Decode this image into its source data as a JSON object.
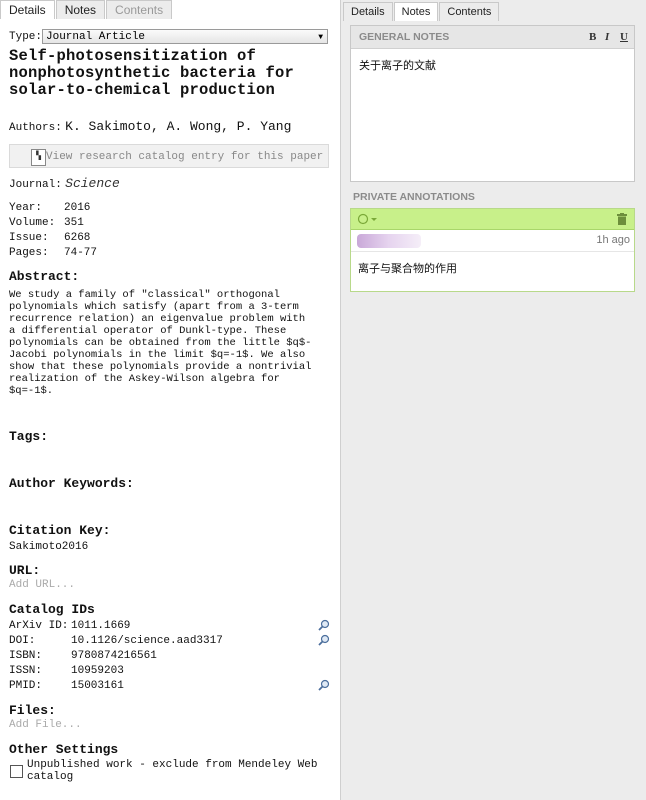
{
  "left_tabs": [
    "Details",
    "Notes",
    "Contents"
  ],
  "right_tabs": [
    "Details",
    "Notes",
    "Contents"
  ],
  "type": {
    "label": "Type:",
    "value": "Journal Article"
  },
  "title": "Self-photosensitization of nonphotosynthetic bacteria for solar-to-chemical production",
  "authors": {
    "label": "Authors:",
    "value": "K. Sakimoto, A. Wong, P. Yang"
  },
  "catalog_button": "View research catalog entry for this paper",
  "journal": {
    "label": "Journal:",
    "value": "Science"
  },
  "meta": [
    {
      "k": "Year:",
      "v": "2016"
    },
    {
      "k": "Volume:",
      "v": "351"
    },
    {
      "k": "Issue:",
      "v": "6268"
    },
    {
      "k": "Pages:",
      "v": "74-77"
    }
  ],
  "abstract": {
    "heading": "Abstract:",
    "text": "We study a family of \"classical\" orthogonal\npolynomials which satisfy (apart from a 3-term\nrecurrence relation) an eigenvalue problem with\na differential operator of Dunkl-type. These\npolynomials can be obtained from the little $q$-\nJacobi polynomials in the limit $q=-1$. We also\nshow that these polynomials provide a nontrivial\nrealization of the Askey-Wilson algebra for\n$q=-1$."
  },
  "tags_heading": "Tags:",
  "author_keywords_heading": "Author Keywords:",
  "citation_key": {
    "heading": "Citation Key:",
    "value": "Sakimoto2016"
  },
  "url": {
    "heading": "URL:",
    "placeholder": "Add URL..."
  },
  "catalog_ids": {
    "heading": "Catalog IDs",
    "rows": [
      {
        "k": "ArXiv ID:",
        "v": "1011.1669"
      },
      {
        "k": "DOI:",
        "v": "10.1126/science.aad3317"
      },
      {
        "k": "ISBN:",
        "v": "9780874216561"
      },
      {
        "k": "ISSN:",
        "v": "10959203"
      },
      {
        "k": "PMID:",
        "v": "15003161"
      }
    ]
  },
  "files": {
    "heading": "Files:",
    "placeholder": "Add File..."
  },
  "other_settings": {
    "heading": "Other Settings",
    "checkbox_label": "Unpublished work - exclude from Mendeley Web catalog"
  },
  "general_notes": {
    "heading": "GENERAL NOTES",
    "bold": "B",
    "italic": "I",
    "underline": "U",
    "text": "关于离子的文献"
  },
  "private_annotations": {
    "heading": "PRIVATE ANNOTATIONS",
    "time": "1h ago",
    "text": "离子与聚合物的作用"
  },
  "colors": {
    "annotation_header": "#c8f08a",
    "panel_bg": "#ececec"
  }
}
